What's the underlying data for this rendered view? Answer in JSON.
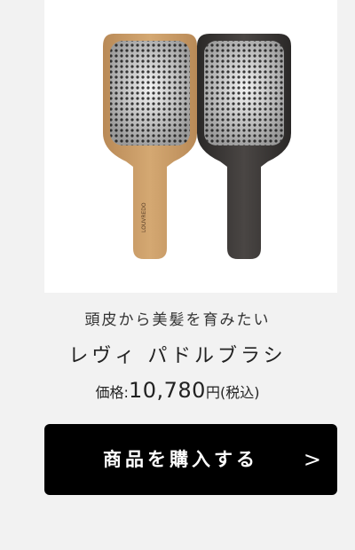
{
  "product": {
    "tagline": "頭皮から美髪を育みたい",
    "name": "レヴィ パドルブラシ",
    "price_label": "価格:",
    "price_value": "10,780",
    "currency": "円",
    "tax_note": "(税込)",
    "image": {
      "brush_left_logo": "LOUVREDO",
      "brush_left_color": "#c99a64",
      "brush_right_color": "#3a3735"
    }
  },
  "cta": {
    "label": "商品を購入する",
    "arrow": ">"
  }
}
